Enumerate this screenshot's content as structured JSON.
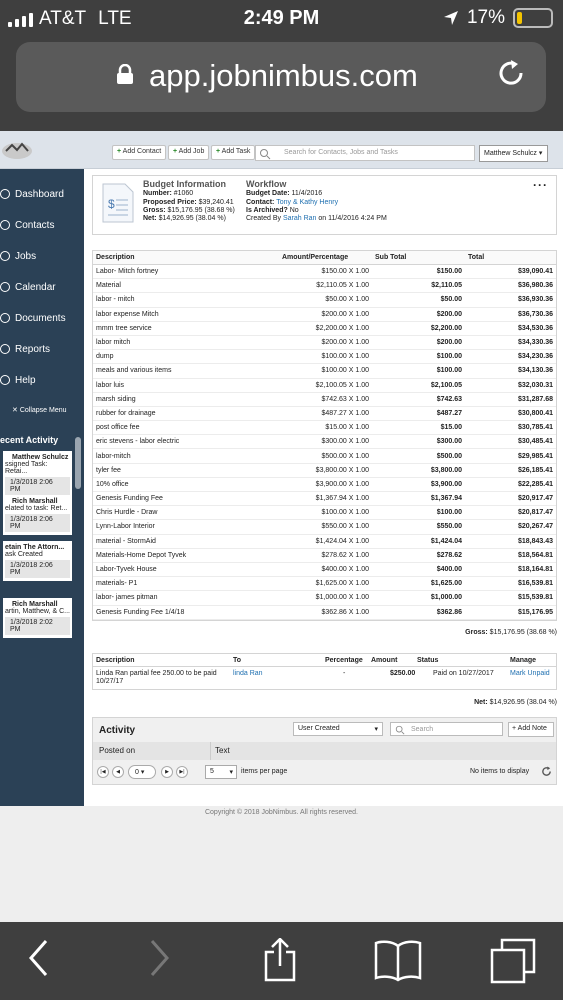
{
  "status": {
    "carrier": "AT&T",
    "network": "LTE",
    "time": "2:49 PM",
    "battery": "17%",
    "battery_level": 0.17
  },
  "browser": {
    "url": "app.jobnimbus.com"
  },
  "topbar": {
    "add_contact": "Add Contact",
    "add_job": "Add Job",
    "add_task": "Add Task",
    "search_placeholder": "Search for Contacts, Jobs and Tasks",
    "user": "Matthew Schulcz"
  },
  "sidebar": {
    "items": [
      {
        "label": "Dashboard"
      },
      {
        "label": "Contacts"
      },
      {
        "label": "Jobs"
      },
      {
        "label": "Calendar"
      },
      {
        "label": "Documents"
      },
      {
        "label": "Reports"
      },
      {
        "label": "Help"
      }
    ],
    "collapse": "Collapse Menu",
    "recent_title": "ecent Activity",
    "recent": [
      {
        "name": "Matthew Schulcz",
        "text": "ssigned Task: Retai...",
        "date": "1/3/2018 2:06 PM"
      },
      {
        "name": "Rich Marshall",
        "text": "elated to task: Ret...",
        "date": "1/3/2018 2:06 PM"
      },
      {
        "name": "etain The Attorn...",
        "text": "ask Created",
        "date": "1/3/2018 2:06 PM"
      },
      {
        "name": "Rich Marshall",
        "text": "artin, Matthew, & C...",
        "date": "1/3/2018 2:02 PM"
      }
    ]
  },
  "budget": {
    "title": "Budget Information",
    "number_label": "Number:",
    "number": "#1060",
    "proposed_label": "Proposed Price:",
    "proposed": "$39,240.41",
    "gross_label": "Gross:",
    "gross": "$15,176.95 (38.68 %)",
    "net_label": "Net:",
    "net": "$14,926.95 (38.04 %)"
  },
  "workflow": {
    "title": "Workflow",
    "date_label": "Budget Date:",
    "date": "11/4/2016",
    "contact_label": "Contact:",
    "contact": "Tony & Kathy Henry",
    "archived_label": "Is Archived?",
    "archived": "No",
    "created_prefix": "Created By",
    "created_by": "Sarah Ran",
    "created_on": "on 11/4/2016 4:24 PM"
  },
  "items_table": {
    "headers": [
      "Description",
      "Amount/Percentage",
      "Sub Total",
      "Total"
    ],
    "rows": [
      [
        "Labor- Mitch fortney",
        "$150.00 X 1.00",
        "$150.00",
        "$39,090.41"
      ],
      [
        "Material",
        "$2,110.05 X 1.00",
        "$2,110.05",
        "$36,980.36"
      ],
      [
        "labor - mitch",
        "$50.00 X 1.00",
        "$50.00",
        "$36,930.36"
      ],
      [
        "labor expense Mitch",
        "$200.00 X 1.00",
        "$200.00",
        "$36,730.36"
      ],
      [
        "mmm tree service",
        "$2,200.00 X 1.00",
        "$2,200.00",
        "$34,530.36"
      ],
      [
        "labor mitch",
        "$200.00 X 1.00",
        "$200.00",
        "$34,330.36"
      ],
      [
        "dump",
        "$100.00 X 1.00",
        "$100.00",
        "$34,230.36"
      ],
      [
        "meals and various items",
        "$100.00 X 1.00",
        "$100.00",
        "$34,130.36"
      ],
      [
        "labor luis",
        "$2,100.05 X 1.00",
        "$2,100.05",
        "$32,030.31"
      ],
      [
        "marsh siding",
        "$742.63 X 1.00",
        "$742.63",
        "$31,287.68"
      ],
      [
        "rubber for drainage",
        "$487.27 X 1.00",
        "$487.27",
        "$30,800.41"
      ],
      [
        "post office fee",
        "$15.00 X 1.00",
        "$15.00",
        "$30,785.41"
      ],
      [
        "eric stevens - labor electric",
        "$300.00 X 1.00",
        "$300.00",
        "$30,485.41"
      ],
      [
        "labor-mitch",
        "$500.00 X 1.00",
        "$500.00",
        "$29,985.41"
      ],
      [
        "tyler fee",
        "$3,800.00 X 1.00",
        "$3,800.00",
        "$26,185.41"
      ],
      [
        "10% office",
        "$3,900.00 X 1.00",
        "$3,900.00",
        "$22,285.41"
      ],
      [
        "Genesis Funding Fee",
        "$1,367.94 X 1.00",
        "$1,367.94",
        "$20,917.47"
      ],
      [
        "Chris Hurdle - Draw",
        "$100.00 X 1.00",
        "$100.00",
        "$20,817.47"
      ],
      [
        "Lynn-Labor Interior",
        "$550.00 X 1.00",
        "$550.00",
        "$20,267.47"
      ],
      [
        "material - StormAid",
        "$1,424.04 X 1.00",
        "$1,424.04",
        "$18,843.43"
      ],
      [
        "Materials-Home Depot Tyvek",
        "$278.62 X 1.00",
        "$278.62",
        "$18,564.81"
      ],
      [
        "Labor-Tyvek House",
        "$400.00 X 1.00",
        "$400.00",
        "$18,164.81"
      ],
      [
        "materials- P1",
        "$1,625.00 X 1.00",
        "$1,625.00",
        "$16,539.81"
      ],
      [
        "labor- james pitman",
        "$1,000.00 X 1.00",
        "$1,000.00",
        "$15,539.81"
      ],
      [
        "Genesis Funding Fee 1/4/18",
        "$362.86 X 1.00",
        "$362.86",
        "$15,176.95"
      ]
    ],
    "gross_label": "Gross:",
    "gross": "$15,176.95 (38.68 %)"
  },
  "payments": {
    "headers": {
      "description": "Description",
      "to": "To",
      "percentage": "Percentage",
      "amount": "Amount",
      "status": "Status",
      "manage": "Manage"
    },
    "row": {
      "description": "Linda Ran partial fee 250.00 to be paid 10/27/17",
      "to": "linda Ran",
      "percentage": "-",
      "amount": "$250.00",
      "status": "Paid on 10/27/2017",
      "manage": "Mark Unpaid"
    },
    "net_label": "Net:",
    "net": "$14,926.95 (38.04 %)"
  },
  "activity": {
    "title": "Activity",
    "filter": "User Created",
    "search_placeholder": "Search",
    "add_note": "Add Note",
    "col_posted": "Posted on",
    "col_text": "Text",
    "page": "0",
    "per_page": "5",
    "per_page_label": "items per page",
    "empty": "No items to display"
  },
  "footer": "Copyright © 2018 JobNimbus. All rights reserved."
}
